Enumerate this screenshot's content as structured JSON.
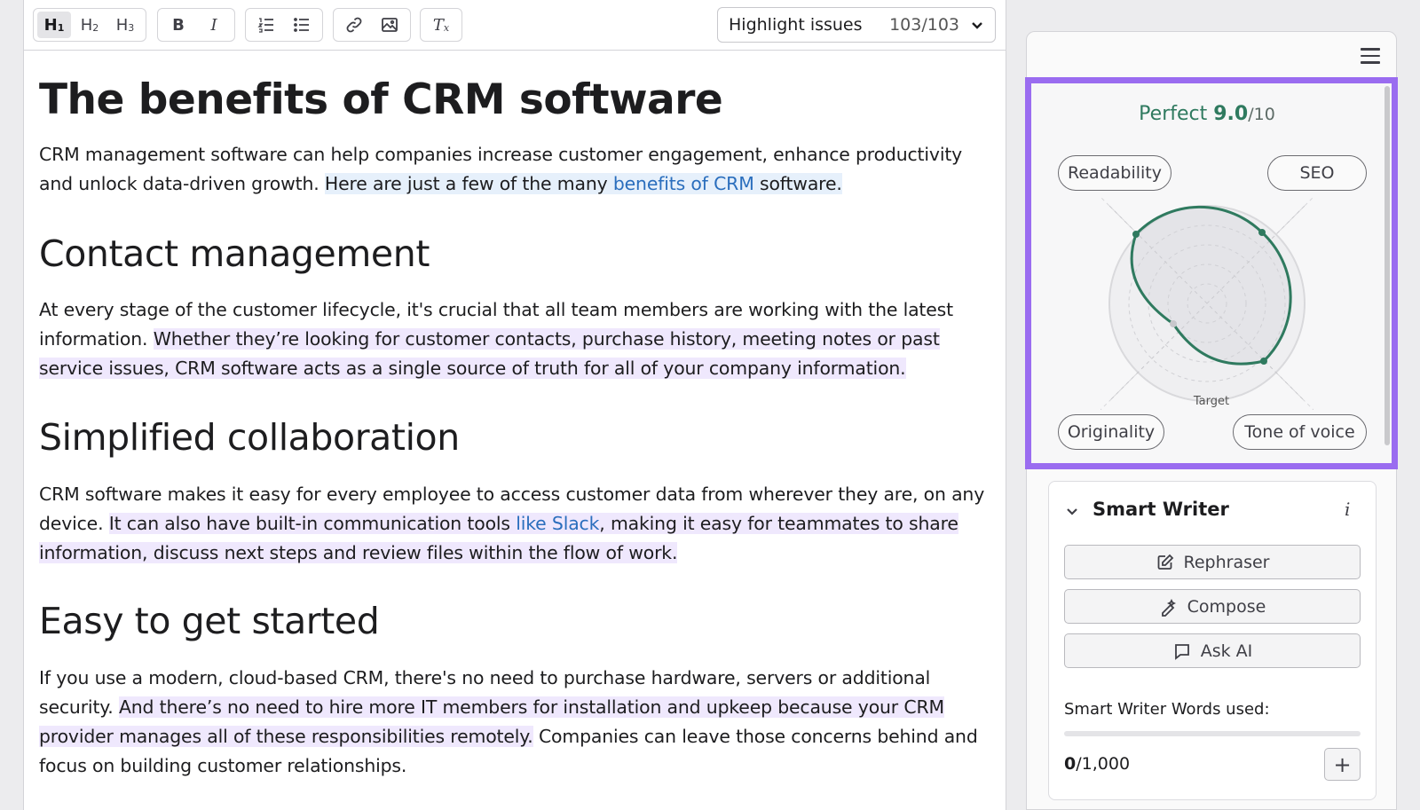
{
  "toolbar": {
    "h1": "H",
    "h1_sub": "1",
    "h2": "H",
    "h2_sub": "2",
    "h3": "H",
    "h3_sub": "3",
    "bold": "B",
    "italic": "I",
    "clear_format": "T",
    "clear_sub": "x",
    "highlight_label": "Highlight issues",
    "highlight_count": "103/103"
  },
  "document": {
    "title": "The benefits of CRM software",
    "intro": {
      "plain": "CRM management software can help companies increase customer engagement, enhance productivity and unlock data-driven growth. ",
      "hl_start": "Here are just a few of the many ",
      "link": "benefits of CRM",
      "hl_end": " software."
    },
    "sections": [
      {
        "heading": "Contact management",
        "plain": "At every stage of the customer lifecycle, it's crucial that all team members are working with the latest information. ",
        "hl": "Whether they’re looking for customer contacts, purchase history, meeting notes or past service issues, CRM software acts as a single source of truth for all of your company information."
      },
      {
        "heading": "Simplified collaboration",
        "plain": "CRM software makes it easy for every employee to access customer data from wherever they are, on any device. ",
        "hl_start": "It can also have built-in communication tools ",
        "link": "like Slack",
        "hl_end": ", making it easy for teammates to share information, discuss next steps and review files within the flow of work."
      },
      {
        "heading": "Easy to get started",
        "plain": "If you use a modern, cloud-based CRM, there's no need to purchase hardware, servers or additional security. ",
        "hl": "And there’s no need to hire more IT members for installation and upkeep because your CRM provider manages all of these responsibilities remotely.",
        "plain_end": " Companies can leave those concerns behind and focus on building customer relationships."
      }
    ]
  },
  "score": {
    "rating": "Perfect",
    "value": "9.0",
    "max": "/10",
    "color": "#2f7a5f",
    "categories": [
      "Readability",
      "SEO",
      "Originality",
      "Tone of voice"
    ],
    "target_label": "Target"
  },
  "smart_writer": {
    "title": "Smart Writer",
    "info": "i",
    "buttons": [
      "Rephraser",
      "Compose",
      "Ask AI"
    ],
    "words_label": "Smart Writer Words used:",
    "words_used": "0",
    "words_limit": "/1,000",
    "words_fraction": 0,
    "plus": "+"
  },
  "colors": {
    "accent_purple": "#9a6cf0",
    "score_green": "#2f7a5f",
    "highlight_blue": "#e6f0fb",
    "highlight_purple": "#efe8fd",
    "link_blue": "#2a6ebd"
  },
  "icons": [
    "numbered-list-icon",
    "bulleted-list-icon",
    "link-icon",
    "image-icon",
    "chevron-down-icon",
    "hamburger-menu-icon",
    "edit-icon",
    "magic-pen-icon",
    "chat-bubble-icon"
  ]
}
